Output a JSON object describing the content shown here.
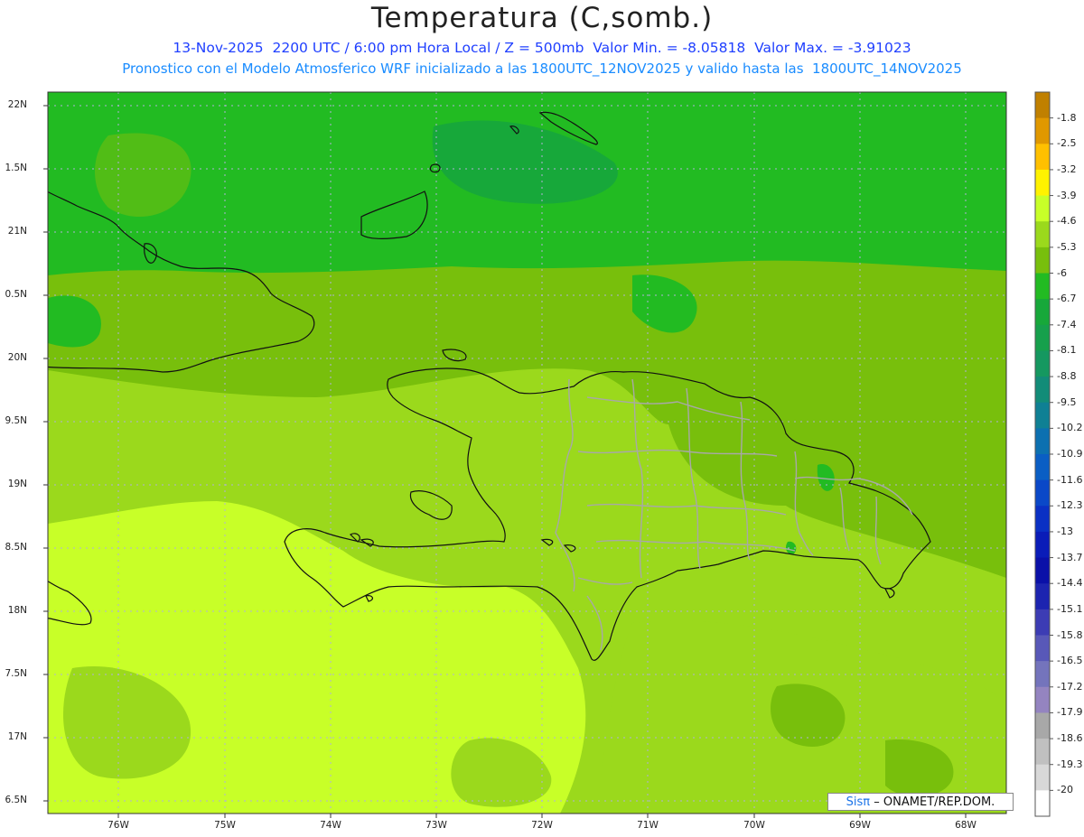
{
  "header": {
    "title": "Temperatura (C,somb.)",
    "line1": "13-Nov-2025  2200 UTC / 6:00 pm Hora Local / Z = 500mb  Valor Min. = -8.05818  Valor Max. = -3.91023",
    "line2": "Pronostico con el Modelo Atmosferico WRF inicializado a las 1800UTC_12NOV2025 y valido hasta las  1800UTC_14NOV2025"
  },
  "axes": {
    "lat_labels": [
      "22N",
      "1.5N",
      "21N",
      "0.5N",
      "20N",
      "9.5N",
      "19N",
      "8.5N",
      "18N",
      "7.5N",
      "17N",
      "6.5N"
    ],
    "lon_labels": [
      "76W",
      "75W",
      "74W",
      "73W",
      "72W",
      "71W",
      "70W",
      "69W",
      "68W"
    ]
  },
  "colorbar": {
    "labels": [
      "-1.8",
      "-2.5",
      "-3.2",
      "-3.9",
      "-4.6",
      "-5.3",
      "-6",
      "-6.7",
      "-7.4",
      "-8.1",
      "-8.8",
      "-9.5",
      "-10.2",
      "-10.9",
      "-11.6",
      "-12.3",
      "-13",
      "-13.7",
      "-14.4",
      "-15.1",
      "-15.8",
      "-16.5",
      "-17.2",
      "-17.9",
      "-18.6",
      "-19.3",
      "-20"
    ],
    "colors": [
      "#c08000",
      "#e09800",
      "#ffc000",
      "#fff200",
      "#c8ff28",
      "#9bd91c",
      "#78bf0c",
      "#22bb22",
      "#17a83a",
      "#16a04c",
      "#159860",
      "#128c78",
      "#0f8094",
      "#0c70b0",
      "#0a5ec4",
      "#0a48c8",
      "#0a30c4",
      "#0a1cb8",
      "#0a10a8",
      "#1c24b0",
      "#3c3cb4",
      "#5858b8",
      "#7474bc",
      "#9484c0",
      "#a8a8a8",
      "#c0c0c0",
      "#d8d8d8",
      "#ffffff"
    ]
  },
  "credit": {
    "brand": "Sisπ",
    "text": "– ONAMET/REP.DOM."
  }
}
